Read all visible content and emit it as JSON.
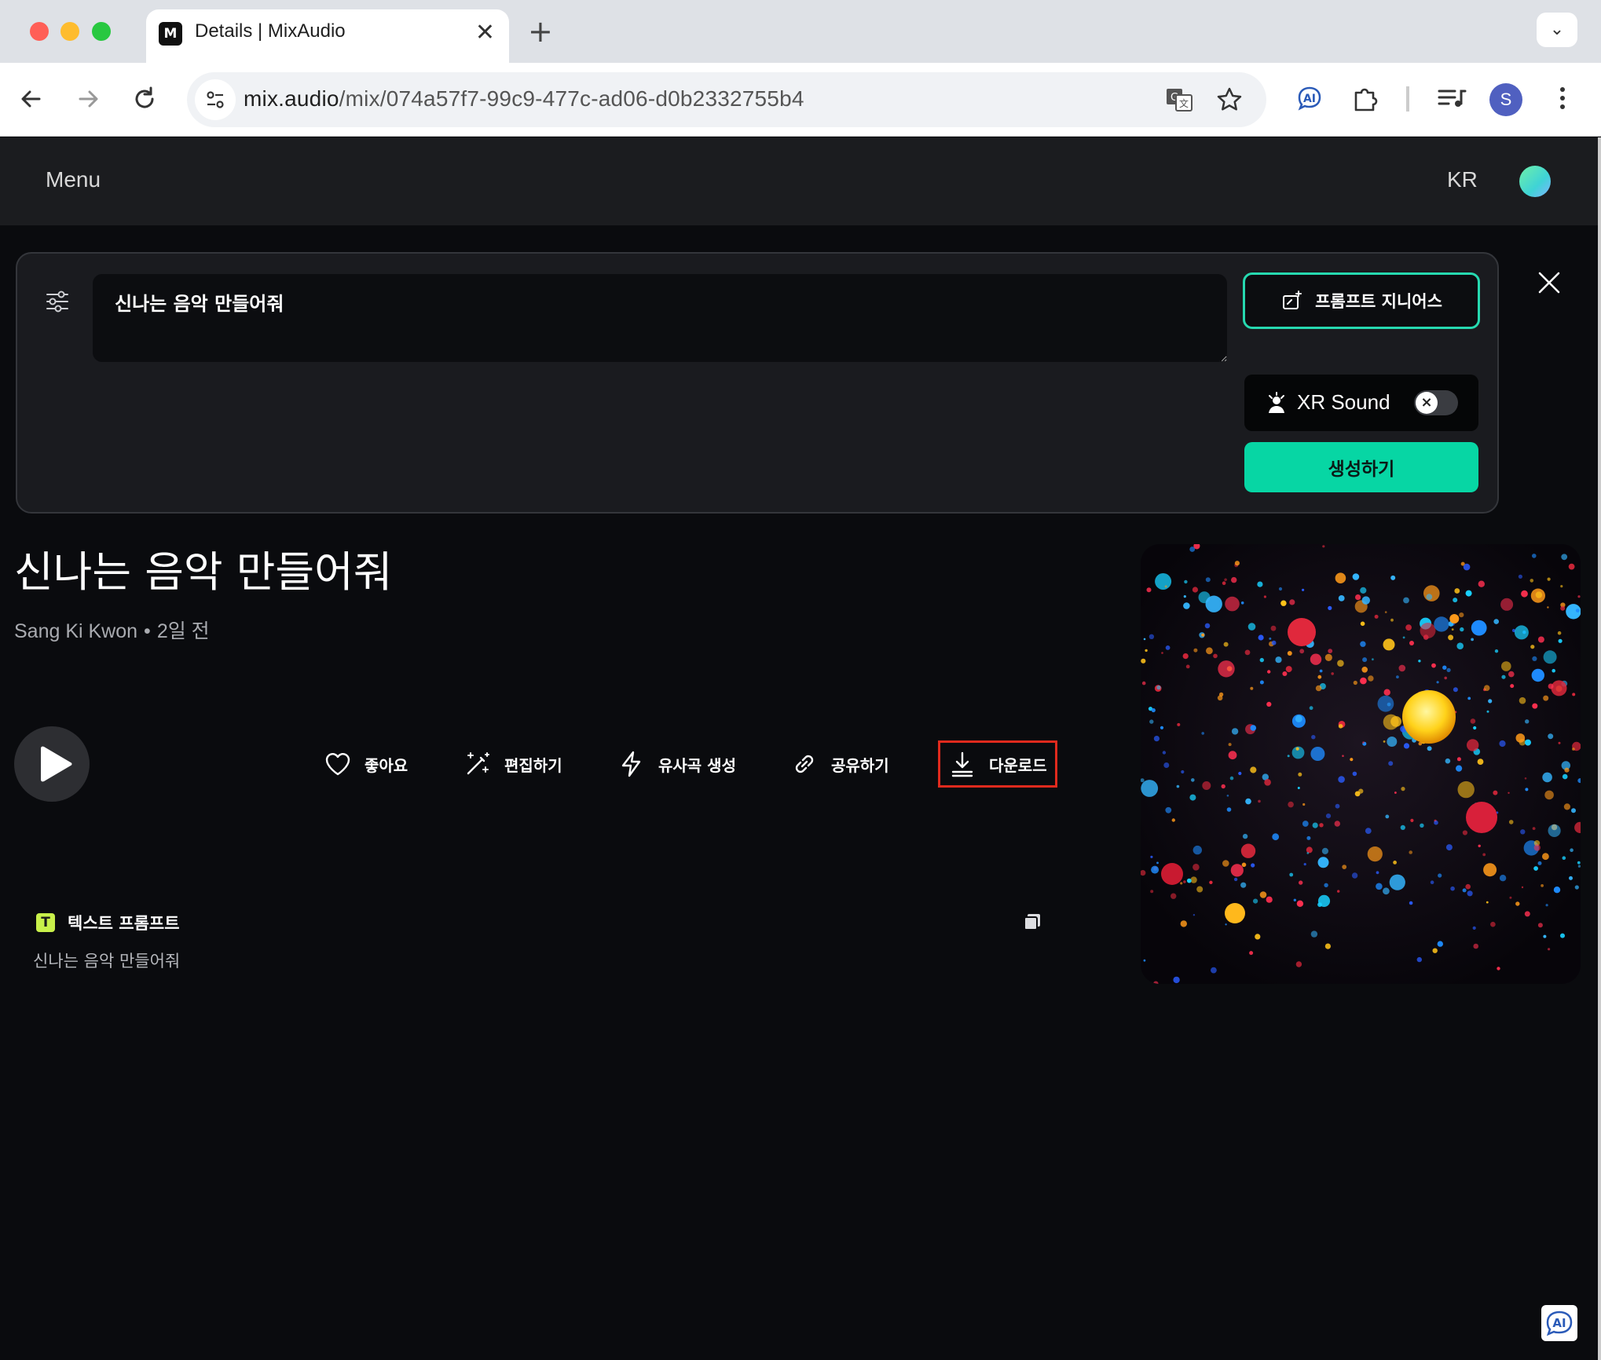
{
  "browser": {
    "tab_title": "Details | MixAudio",
    "tab_favicon_text": "M",
    "url_host": "mix.audio",
    "url_path": "/mix/074a57f7-99c9-477c-ad06-d0b2332755b4",
    "profile_initial": "S"
  },
  "header": {
    "menu_label": "Menu",
    "lang_label": "KR"
  },
  "prompt_panel": {
    "prompt_value": "신나는 음악 만들어줘",
    "genius_label": "프롬프트 지니어스",
    "xr_label": "XR Sound",
    "xr_enabled": false,
    "generate_label": "생성하기"
  },
  "song": {
    "title": "신나는 음악 만들어줘",
    "author": "Sang Ki Kwon",
    "separator": "•",
    "time_ago": "2일 전"
  },
  "actions": {
    "like": "좋아요",
    "edit": "편집하기",
    "similar": "유사곡 생성",
    "share": "공유하기",
    "download": "다운로드"
  },
  "text_prompt": {
    "badge": "T",
    "label": "텍스트 프롬프트",
    "value": "신나는 음악 만들어줘"
  },
  "colors": {
    "accent": "#07d6a4",
    "highlight": "#e02a1d",
    "background": "#0a0b0e"
  },
  "icons": [
    "filter-icon",
    "magic-wand-icon",
    "xr-person-icon",
    "close-icon",
    "play-icon",
    "heart-icon",
    "wand-icon",
    "lightning-icon",
    "link-icon",
    "download-icon",
    "copy-icon"
  ]
}
